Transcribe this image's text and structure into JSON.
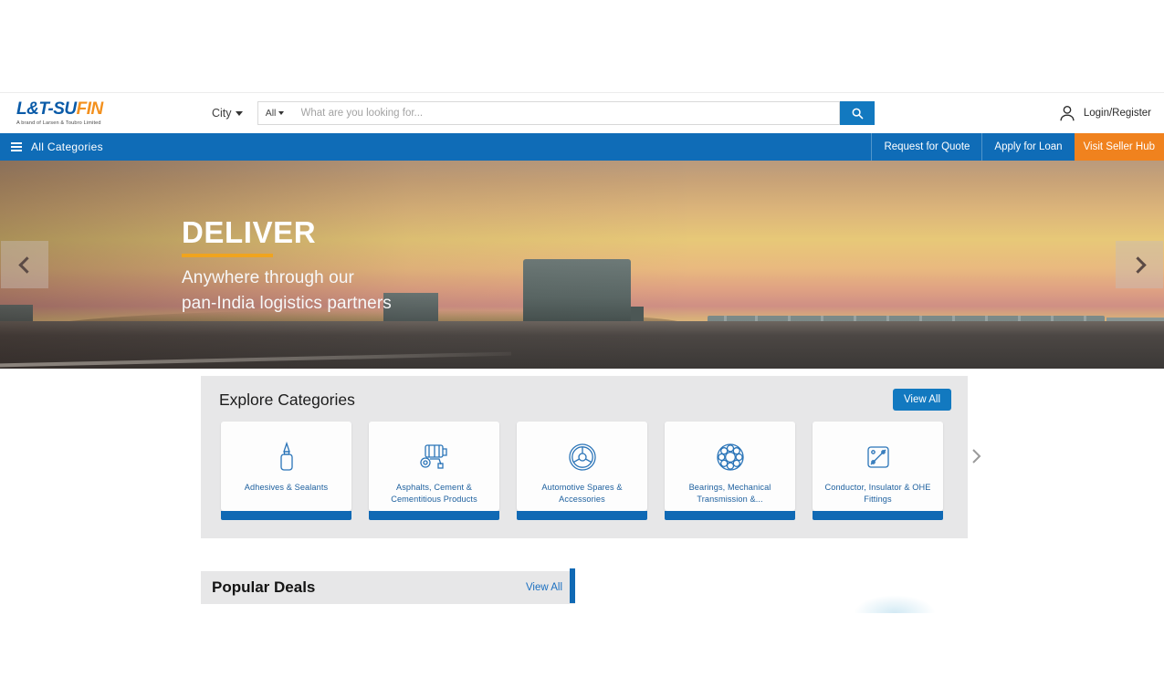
{
  "header": {
    "logo": {
      "part_blue": "L&T-SU",
      "part_orange": "FIN",
      "tagline": "A brand of Larsen & Toubro Limited"
    },
    "city_selector": {
      "label": "City",
      "icon": "chevron-down-icon"
    },
    "search": {
      "category_label": "All",
      "placeholder": "What are you looking for...",
      "value": "",
      "button_icon": "search-icon"
    },
    "account": {
      "label": "Login/Register",
      "icon": "user-icon"
    }
  },
  "navbar": {
    "all_categories": {
      "label": "All Categories",
      "icon": "menu-icon"
    },
    "items": [
      {
        "label": "Request for Quote",
        "style": "link"
      },
      {
        "label": "Apply for Loan",
        "style": "link"
      },
      {
        "label": "Visit Seller Hub",
        "style": "highlight"
      }
    ],
    "colors": {
      "bar": "#0f6cb7",
      "highlight": "#f0821e"
    }
  },
  "hero": {
    "title": "DELIVER",
    "subtitle_line1": "Anywhere through our",
    "subtitle_line2": "pan-India logistics partners",
    "underline_color": "#f0a41e",
    "prev_icon": "chevron-left-icon",
    "next_icon": "chevron-right-icon"
  },
  "categories": {
    "title": "Explore Categories",
    "view_all_label": "View All",
    "next_icon": "chevron-right-icon",
    "accent_color": "#1069b4",
    "items": [
      {
        "label": "Adhesives & Sealants",
        "icon": "glue-bottle-icon"
      },
      {
        "label": "Asphalts, Cement & Cementitious Products",
        "icon": "cement-mixer-icon"
      },
      {
        "label": "Automotive Spares & Accessories",
        "icon": "steering-wheel-icon"
      },
      {
        "label": "Bearings, Mechanical Transmission &...",
        "icon": "ball-bearing-icon"
      },
      {
        "label": "Conductor, Insulator & OHE Fittings",
        "icon": "insulator-plate-icon"
      }
    ]
  },
  "popular_deals": {
    "title": "Popular Deals",
    "view_all_label": "View All",
    "accent_color": "#1069b4"
  }
}
